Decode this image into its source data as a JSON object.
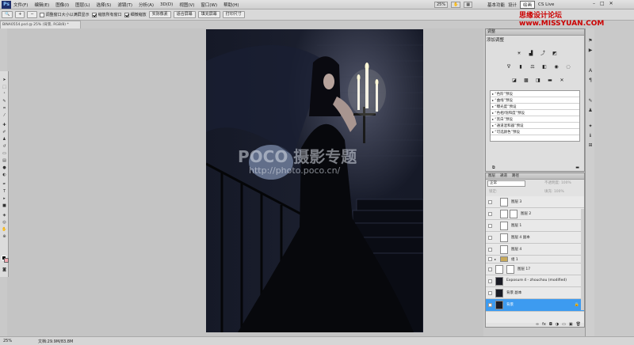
{
  "menubar": {
    "logo": "Ps",
    "menus": [
      "文件(F)",
      "编辑(E)",
      "图像(I)",
      "图层(L)",
      "选择(S)",
      "滤镜(T)",
      "分析(A)",
      "3D(D)",
      "视图(V)",
      "窗口(W)",
      "帮助(H)"
    ],
    "zoom_value": "25%",
    "workspaces": [
      "基本功能",
      "设计",
      "绘画"
    ],
    "cs_live": "CS Live",
    "watermark": "思缘设计论坛 www.MISSYUAN.COM"
  },
  "options": {
    "chk_resize": "调整窗口大小以满屏显示",
    "chk_all_windows": "缩放所有窗口",
    "chk_scrubby": "细微缩放",
    "btn_actual": "实际像素",
    "btn_fit": "适合屏幕",
    "btn_fill": "填充屏幕",
    "btn_print": "打印尺寸"
  },
  "document": {
    "tab_title": "BINA0554.psd @ 25% (背景, RGB/8) *",
    "watermark_brand": "POCO 摄影专题",
    "watermark_url": "http://photo.poco.cn/"
  },
  "adjustments": {
    "panel_title": "调整",
    "heading": "添加调整",
    "presets": [
      "“色阶”预设",
      "“曲线”预设",
      "“曝光度”预设",
      "“色相/饱和度”预设",
      "“黑白”预设",
      "“通道混和器”预设",
      "“可选颜色”预设"
    ]
  },
  "layers": {
    "tabs": [
      "图层",
      "通道",
      "路径"
    ],
    "blend_mode": "正常",
    "opacity_label": "不透明度: 100%",
    "lock_label": "锁定:",
    "fill_label": "填充: 100%",
    "items": [
      {
        "name": "图层 3"
      },
      {
        "name": "图层 2"
      },
      {
        "name": "图层 1"
      },
      {
        "name": "图层 4 副本"
      },
      {
        "name": "图层 4"
      },
      {
        "name": "组 1"
      },
      {
        "name": "图层 17"
      },
      {
        "name": "Exposure 4 - zhouchou (modified)"
      },
      {
        "name": "背景 副本"
      },
      {
        "name": "背景"
      }
    ]
  },
  "status": {
    "zoom": "25%",
    "doc_size": "文档:29.9M/83.8M"
  },
  "colors": {
    "selection": "#3d9bf0",
    "foreground": "#000000",
    "background": "#f3a9b2"
  }
}
